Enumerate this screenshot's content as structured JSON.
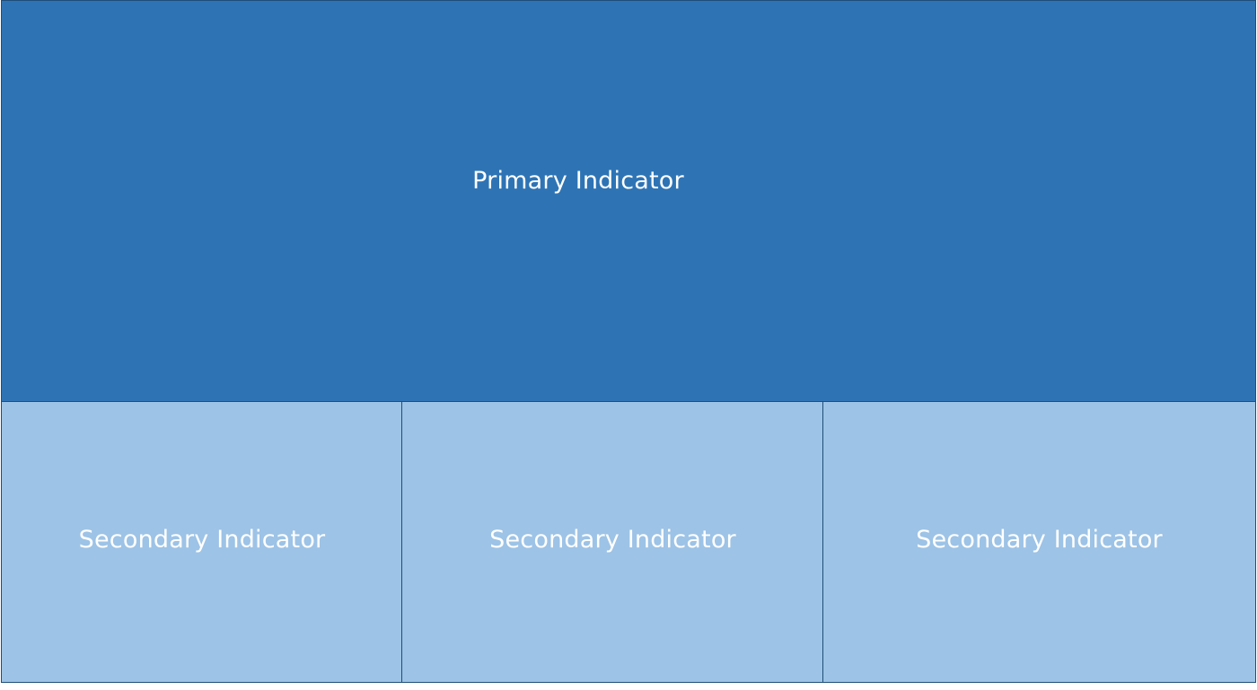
{
  "diagram": {
    "primary": {
      "label": "Primary Indicator",
      "color": "#2e74b5"
    },
    "secondary": [
      {
        "label": "Secondary Indicator",
        "color": "#9dc3e6"
      },
      {
        "label": "Secondary Indicator",
        "color": "#9dc3e6"
      },
      {
        "label": "Secondary Indicator",
        "color": "#9dc3e6"
      }
    ],
    "border_color": "#1f4e79"
  }
}
